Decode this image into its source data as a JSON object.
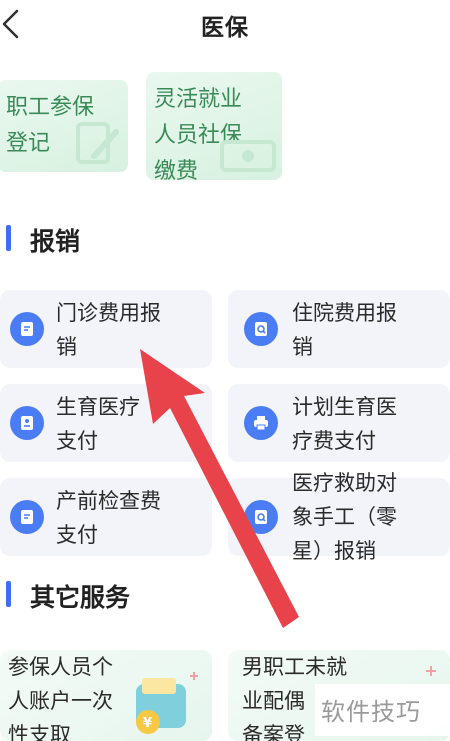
{
  "header": {
    "title": "医保",
    "back_icon": "chevron-left-icon"
  },
  "top_tiles": [
    {
      "label": "职工参保\n登记",
      "icon": "edit-document-icon"
    },
    {
      "label": "灵活就业\n人员社保\n缴费",
      "icon": "banknote-icon"
    }
  ],
  "sections": {
    "reimburse": "报销",
    "other": "其它服务"
  },
  "reimburse_items": [
    {
      "label": "门诊费用报\n销",
      "icon": "document-icon"
    },
    {
      "label": "住院费用报\n销",
      "icon": "search-document-icon"
    },
    {
      "label": "生育医疗\n支付",
      "icon": "clipboard-icon"
    },
    {
      "label": "计划生育医\n疗费支付",
      "icon": "printer-icon"
    },
    {
      "label": "产前检查费\n支付",
      "icon": "document-icon"
    },
    {
      "label": "医疗救助对\n象手工（零\n星）报销",
      "icon": "search-document-icon"
    }
  ],
  "other_items": [
    {
      "label": "参保人员个\n人账户一次\n性支取",
      "icon": "wallet-coin-icon"
    },
    {
      "label": "男职工未就\n业配偶\n备案登",
      "icon": "plus-icon"
    }
  ],
  "watermark": "软件技巧",
  "colors": {
    "accent": "#3d6ef5",
    "icon_bg": "#4a7cf4",
    "arrow": "#e8424a",
    "tile_green": "#3a8a58"
  }
}
